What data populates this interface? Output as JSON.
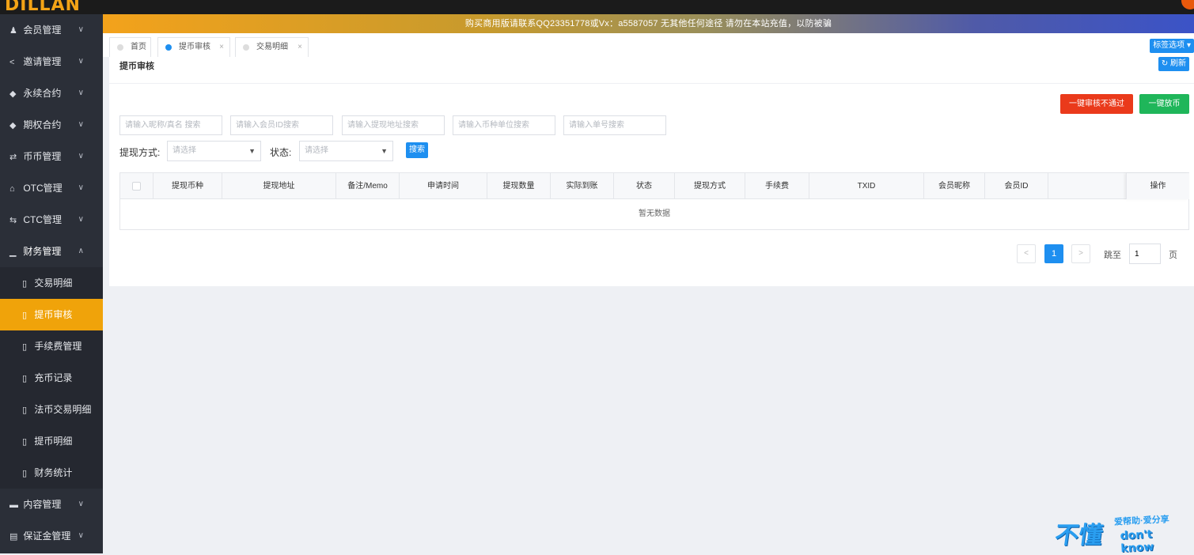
{
  "brand": {
    "logo_text": "DILLAN"
  },
  "notice": {
    "text": "购买商用版请联系QQ23351778或Vx：a5587057 无其他任何途径 请勿在本站充值，以防被骗"
  },
  "sidebar": {
    "items": [
      {
        "icon": "users-icon",
        "glyph": "♟",
        "label": "会员管理",
        "chevron": "∨"
      },
      {
        "icon": "share-icon",
        "glyph": "<",
        "label": "邀请管理",
        "chevron": "∨"
      },
      {
        "icon": "cube-icon",
        "glyph": "◆",
        "label": "永续合约",
        "chevron": "∨"
      },
      {
        "icon": "cube-icon",
        "glyph": "◆",
        "label": "期权合约",
        "chevron": "∨"
      },
      {
        "icon": "exchange-icon",
        "glyph": "⇄",
        "label": "币币管理",
        "chevron": "∨"
      },
      {
        "icon": "bank-icon",
        "glyph": "⌂",
        "label": "OTC管理",
        "chevron": "∨"
      },
      {
        "icon": "exchange-icon",
        "glyph": "⇆",
        "label": "CTC管理",
        "chevron": "∨"
      },
      {
        "icon": "chart-icon",
        "glyph": "▁",
        "label": "财务管理",
        "chevron": "∧"
      }
    ],
    "sub_items": [
      {
        "label": "交易明细"
      },
      {
        "label": "提币审核"
      },
      {
        "label": "手续费管理"
      },
      {
        "label": "充币记录"
      },
      {
        "label": "法币交易明细"
      },
      {
        "label": "提币明细"
      },
      {
        "label": "财务统计"
      }
    ],
    "bottom_items": [
      {
        "icon": "folder-icon",
        "glyph": "▬",
        "label": "内容管理",
        "chevron": "∨"
      },
      {
        "icon": "id-card-icon",
        "glyph": "▤",
        "label": "保证金管理",
        "chevron": "∨"
      }
    ],
    "doc_glyph": "▯"
  },
  "tabs": {
    "items": [
      {
        "label": "首页",
        "active": false
      },
      {
        "label": "提币审核",
        "active": true,
        "close": "×"
      },
      {
        "label": "交易明细",
        "active": false,
        "close": "×"
      }
    ],
    "options_label": "标签选项 ▾"
  },
  "page": {
    "title": "提币审核",
    "refresh_label": "↻ 刷新",
    "btn_reject_all": "一键审核不通过",
    "btn_release_all": "一键放币"
  },
  "filters": {
    "placeholders": [
      "请输入昵称/真名 搜索",
      "请输入会员ID搜索",
      "请输入提现地址搜索",
      "请输入币种单位搜索",
      "请输入单号搜索"
    ],
    "method_label": "提现方式:",
    "status_label": "状态:",
    "select_placeholder": "请选择",
    "search_button": "搜索"
  },
  "table": {
    "columns": [
      "提现币种",
      "提现地址",
      "备注/Memo",
      "申请时间",
      "提现数量",
      "实际到账",
      "状态",
      "提现方式",
      "手续费",
      "TXID",
      "会员昵称",
      "会员ID"
    ],
    "op_column": "操作",
    "empty_text": "暂无数据"
  },
  "pagination": {
    "prev": "<",
    "current": "1",
    "next": ">",
    "goto_label": "跳至",
    "goto_value": "1",
    "page_suffix": "页"
  },
  "watermark": {
    "big": "不懂",
    "top": "爱帮助·爱分享",
    "bottom": "don't know"
  },
  "colors": {
    "accent": "#1e8ff0",
    "active_menu": "#f0a30a",
    "danger": "#ea3a1b",
    "success": "#1fb65a",
    "sidebar_bg": "#2b2f38"
  }
}
